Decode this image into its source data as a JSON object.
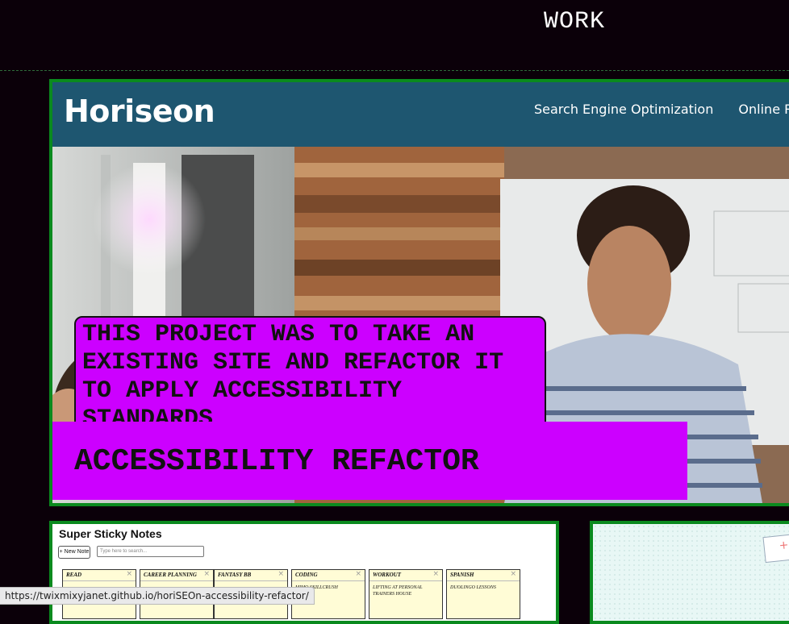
{
  "section": {
    "heading": "WORK"
  },
  "featured": {
    "screenshot": {
      "logo": "Horiseon",
      "nav": [
        "Search Engine Optimization",
        "Online Rep"
      ]
    },
    "description": "THIS PROJECT WAS TO TAKE AN EXISTING SITE AND REFACTOR IT TO APPLY ACCESSIBILITY STANDARDS",
    "title": "ACCESSIBILITY REFACTOR"
  },
  "project2": {
    "app_title": "Super Sticky Notes",
    "new_note_label": "+ New Note",
    "search_placeholder": "Type here to search...",
    "notes": [
      {
        "title": "Read",
        "body": ""
      },
      {
        "title": "Career Planning",
        "body": ""
      },
      {
        "title": "Fantasy BB",
        "body": ""
      },
      {
        "title": "Coding",
        "body": "Mimo Skillcrush"
      },
      {
        "title": "Workout",
        "body": "Lifting at personal trainers house"
      },
      {
        "title": "Spanish",
        "body": "Duolingo lessons"
      }
    ],
    "close_glyph": "×"
  },
  "status_bar": {
    "url": "https://twixmixyjanet.github.io/horiSEOn-accessibility-refactor/"
  },
  "colors": {
    "accent": "#cc00ff",
    "border": "#0a8a1e",
    "background": "#0b0009",
    "header": "#1e5670"
  }
}
